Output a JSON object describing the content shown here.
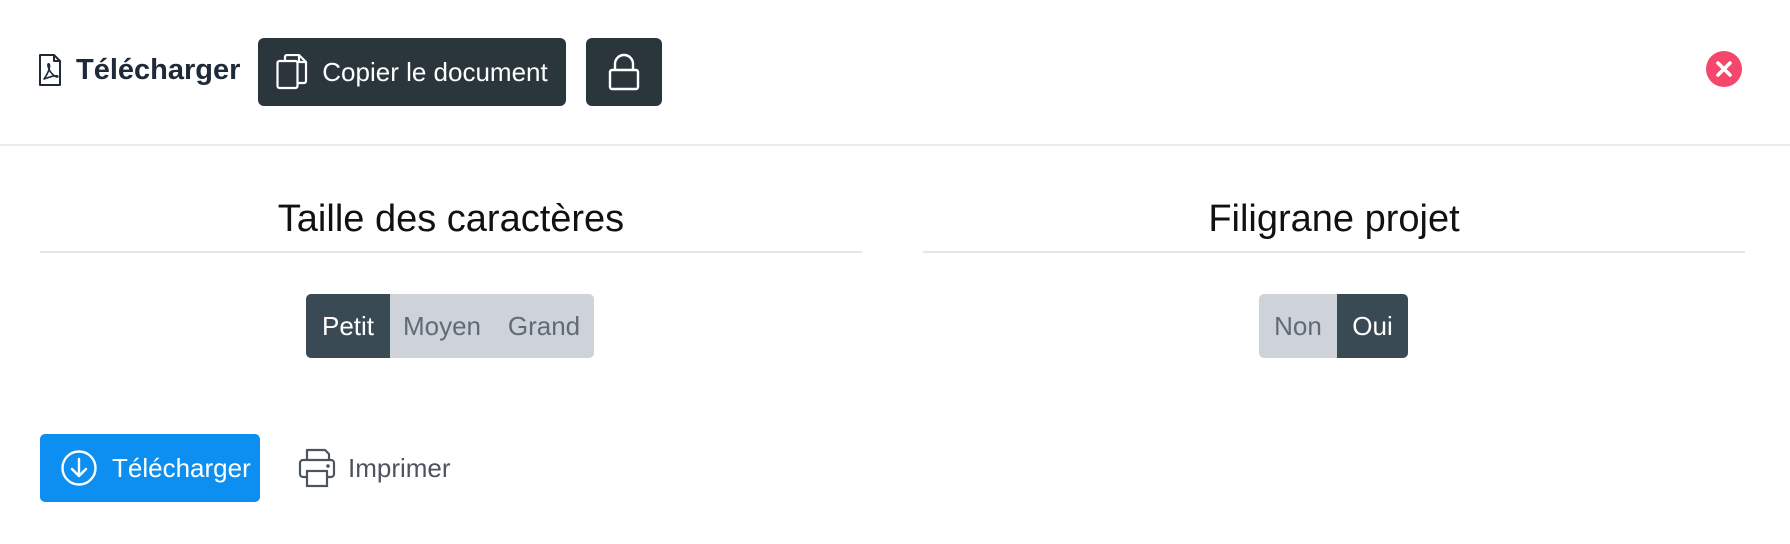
{
  "header": {
    "title": "Télécharger",
    "title_icon": "pdf-file-icon",
    "copy_button_label": "Copier le document",
    "copy_icon": "copy-icon",
    "lock_icon": "lock-icon",
    "close_icon": "close-circle-icon",
    "close_color": "#f5476b"
  },
  "font_size_section": {
    "title": "Taille des caractères",
    "options": [
      "Petit",
      "Moyen",
      "Grand"
    ],
    "selected": "Petit"
  },
  "watermark_section": {
    "title": "Filigrane projet",
    "options": [
      "Non",
      "Oui"
    ],
    "selected": "Oui"
  },
  "actions": {
    "download_label": "Télécharger",
    "download_icon": "download-circle-icon",
    "download_color": "#0d8ff2",
    "print_label": "Imprimer",
    "print_icon": "printer-icon"
  }
}
